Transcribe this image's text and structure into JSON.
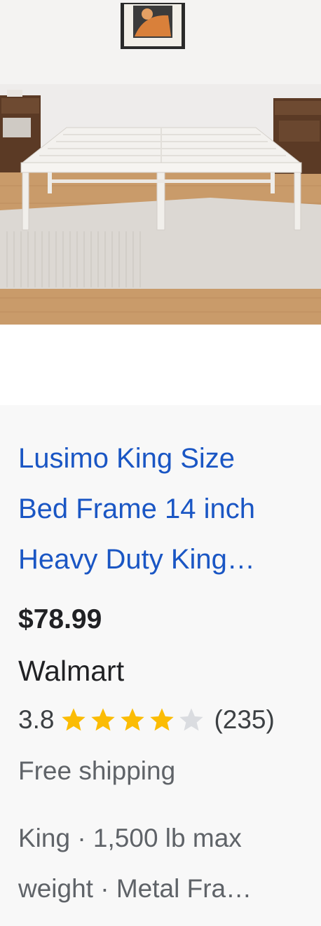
{
  "product": {
    "title_lines": [
      "Lusimo King Size",
      "Bed Frame 14 inch",
      "Heavy Duty King…"
    ],
    "price": "$78.99",
    "merchant": "Walmart",
    "rating": {
      "value": "3.8",
      "stars_filled": 4,
      "stars_total": 5,
      "review_count": "(235)"
    },
    "shipping": "Free shipping",
    "attribute_lines": [
      "King · 1,500 lb max",
      "weight · Metal Fra…"
    ]
  },
  "colors": {
    "title_link": "#1a56c4",
    "star_filled": "#fbbc04",
    "star_empty": "#dadce0",
    "card_background": "#f8f8f8"
  }
}
